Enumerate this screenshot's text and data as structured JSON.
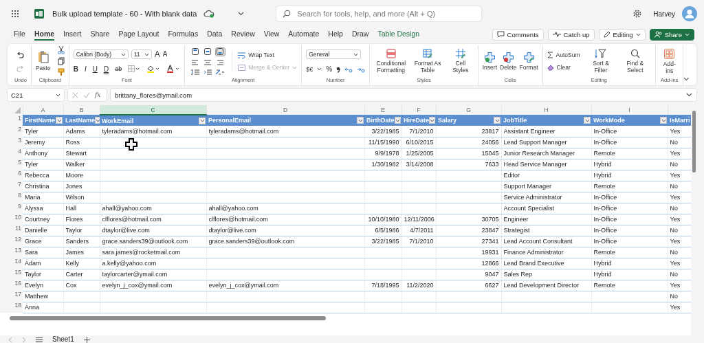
{
  "app_bar": {
    "file_name": "Bulk upload template - 60 - With blank data",
    "search": {
      "placeholder": "Search for tools, help, and more (Alt + Q)"
    },
    "user_name": "Harvey"
  },
  "menu_tabs": [
    {
      "label": "File",
      "selected": false,
      "kind": "standard"
    },
    {
      "label": "Home",
      "selected": true,
      "kind": "standard"
    },
    {
      "label": "Insert",
      "selected": false,
      "kind": "standard"
    },
    {
      "label": "Share",
      "selected": false,
      "kind": "standard"
    },
    {
      "label": "Page Layout",
      "selected": false,
      "kind": "standard"
    },
    {
      "label": "Formulas",
      "selected": false,
      "kind": "standard"
    },
    {
      "label": "Data",
      "selected": false,
      "kind": "standard"
    },
    {
      "label": "Review",
      "selected": false,
      "kind": "standard"
    },
    {
      "label": "View",
      "selected": false,
      "kind": "standard"
    },
    {
      "label": "Automate",
      "selected": false,
      "kind": "standard"
    },
    {
      "label": "Help",
      "selected": false,
      "kind": "standard"
    },
    {
      "label": "Draw",
      "selected": false,
      "kind": "standard"
    },
    {
      "label": "Table Design",
      "selected": false,
      "kind": "contextual"
    }
  ],
  "actions": {
    "comments": "Comments",
    "catch_up": "Catch up",
    "editing": "Editing",
    "share": "Share"
  },
  "ribbon": {
    "undo": {
      "label": "Undo",
      "redo_disabled": true
    },
    "clipboard": {
      "paste": "Paste",
      "label": "Clipboard"
    },
    "font": {
      "family": "Calibri (Body)",
      "size": "11",
      "size_buttons": [
        "A",
        "A"
      ],
      "format_buttons": [
        "B",
        "I",
        "U",
        "D",
        "ab"
      ],
      "label": "Font"
    },
    "alignment": {
      "valign": [
        {
          "selected": false
        },
        {
          "selected": false
        },
        {
          "selected": true
        }
      ],
      "wrap_text": "Wrap Text",
      "merge_center": {
        "text": "Merge & Center",
        "disabled": true
      },
      "label": "Alignment"
    },
    "number": {
      "format": "General",
      "currency": "$€",
      "percent": "%",
      "label": "Number"
    },
    "styles": {
      "buttons": [
        "Conditional Formatting",
        "Format As Table",
        "Cell Styles"
      ],
      "label": "Styles"
    },
    "cells": {
      "buttons": [
        "Insert",
        "Delete",
        "Format"
      ],
      "label": "Cells"
    },
    "editing": {
      "autosum": "AutoSum",
      "clear": "Clear",
      "buttons": [
        "Sort & Filter",
        "Find & Select"
      ],
      "label": "Editing"
    },
    "addins": {
      "buttons": [
        "Add-ins"
      ],
      "label": "Add-ins"
    }
  },
  "formula_bar": {
    "name_box": "C21",
    "function_label": "fx",
    "formula": "brittany_flores@ymail.com"
  },
  "columns": [
    {
      "letter": "A",
      "selected": false
    },
    {
      "letter": "B",
      "selected": false
    },
    {
      "letter": "C",
      "selected": true
    },
    {
      "letter": "D",
      "selected": false
    },
    {
      "letter": "E",
      "selected": false
    },
    {
      "letter": "F",
      "selected": false
    },
    {
      "letter": "G",
      "selected": false
    },
    {
      "letter": "H",
      "selected": false
    },
    {
      "letter": "I",
      "selected": false
    }
  ],
  "table": {
    "header_row_number": "1",
    "headings": [
      {
        "label": "FirstName",
        "kind": "text",
        "filter": true
      },
      {
        "label": "LastName",
        "kind": "text",
        "filter": true
      },
      {
        "label": "WorkEmail",
        "kind": "text",
        "filter": true
      },
      {
        "label": "PersonalEmail",
        "kind": "text",
        "filter": true
      },
      {
        "label": "BirthDate",
        "kind": "number",
        "filter": true
      },
      {
        "label": "HireDate",
        "kind": "number",
        "filter": true
      },
      {
        "label": "Salary",
        "kind": "number",
        "filter": true
      },
      {
        "label": "JobTitle",
        "kind": "text",
        "filter": true
      },
      {
        "label": "WorkMode",
        "kind": "text",
        "filter": true
      },
      {
        "label": "IsMarri",
        "kind": "text",
        "filter": false
      }
    ],
    "rows": [
      {
        "number": "2",
        "cells": [
          "Tyler",
          "Adams",
          "tyleradams@hotmail.com",
          "tyleradams@hotmail.com",
          "3/22/1985",
          "7/1/2010",
          "23817",
          "Assistant Engineer",
          "In-Office",
          "Yes"
        ]
      },
      {
        "number": "3",
        "cells": [
          "Jeremy",
          "Ross",
          null,
          null,
          "11/15/1990",
          "6/10/2015",
          "24056",
          "Lead Support Manager",
          "In-Office",
          "No"
        ]
      },
      {
        "number": "4",
        "cells": [
          "Anthony",
          "Stewart",
          null,
          null,
          "9/9/1978",
          "1/25/2005",
          "15045",
          "Junior Research Manager",
          "Remote",
          "Yes"
        ]
      },
      {
        "number": "5",
        "cells": [
          "Tyler",
          "Walker",
          null,
          null,
          "1/30/1982",
          "3/14/2008",
          "7633",
          "Head Service Manager",
          "Hybrid",
          "No"
        ]
      },
      {
        "number": "6",
        "cells": [
          "Rebecca",
          "Moore",
          null,
          null,
          null,
          null,
          null,
          "Editor",
          "Hybrid",
          "Yes"
        ]
      },
      {
        "number": "7",
        "cells": [
          "Christina",
          "Jones",
          null,
          null,
          null,
          null,
          null,
          "Support Manager",
          "Remote",
          "No"
        ]
      },
      {
        "number": "8",
        "cells": [
          "Maria",
          "Wilson",
          null,
          null,
          null,
          null,
          null,
          "Service Administrator",
          "In-Office",
          "Yes"
        ]
      },
      {
        "number": "9",
        "cells": [
          "Alyssa",
          "Hall",
          "ahall@yahoo.com",
          "ahall@yahoo.com",
          null,
          null,
          null,
          "Account Specialist",
          "In-Office",
          "No"
        ]
      },
      {
        "number": "10",
        "cells": [
          "Courtney",
          "Flores",
          "clflores@hotmail.com",
          "clflores@hotmail.com",
          "10/10/1980",
          "12/11/2006",
          "30705",
          "Engineer",
          "In-Office",
          "Yes"
        ]
      },
      {
        "number": "11",
        "cells": [
          "Danielle",
          "Taylor",
          "dtaylor@live.com",
          "dtaylor@live.com",
          "6/5/1986",
          "4/7/2011",
          "23847",
          "Strategist",
          "In-Office",
          "No"
        ]
      },
      {
        "number": "12",
        "cells": [
          "Grace",
          "Sanders",
          "grace.sanders39@outlook.com",
          "grace.sanders39@outlook.com",
          "3/22/1985",
          "7/1/2010",
          "27341",
          "Lead Account Consultant",
          "In-Office",
          "Yes"
        ]
      },
      {
        "number": "13",
        "cells": [
          "Sara",
          "James",
          "sara.james@rocketmail.com",
          null,
          null,
          null,
          "19931",
          "Finance Administrator",
          "Remote",
          "No"
        ]
      },
      {
        "number": "14",
        "cells": [
          "Adam",
          "Kelly",
          "a.kelly@yahoo.com",
          null,
          null,
          null,
          "12866",
          "Lead Brand Executive",
          "Hybrid",
          "Yes"
        ]
      },
      {
        "number": "15",
        "cells": [
          "Taylor",
          "Carter",
          "taylorcarter@ymail.com",
          null,
          null,
          null,
          "9047",
          "Sales Rep",
          "Hybrid",
          "No"
        ]
      },
      {
        "number": "16",
        "cells": [
          "Evelyn",
          "Cox",
          "evelyn_j_cox@ymail.com",
          "evelyn_j_cox@ymail.com",
          "7/18/1995",
          "11/2/2020",
          "6627",
          "Lead Development Director",
          "Remote",
          "Yes"
        ]
      },
      {
        "number": "17",
        "cells": [
          "Matthew",
          null,
          null,
          null,
          null,
          null,
          null,
          null,
          null,
          "No"
        ]
      },
      {
        "number": "18",
        "cells": [
          "Anna",
          null,
          null,
          null,
          null,
          null,
          null,
          null,
          null,
          "Yes"
        ]
      }
    ]
  },
  "sheet_tabs": [
    {
      "label": "Sheet1",
      "selected": true
    }
  ]
}
